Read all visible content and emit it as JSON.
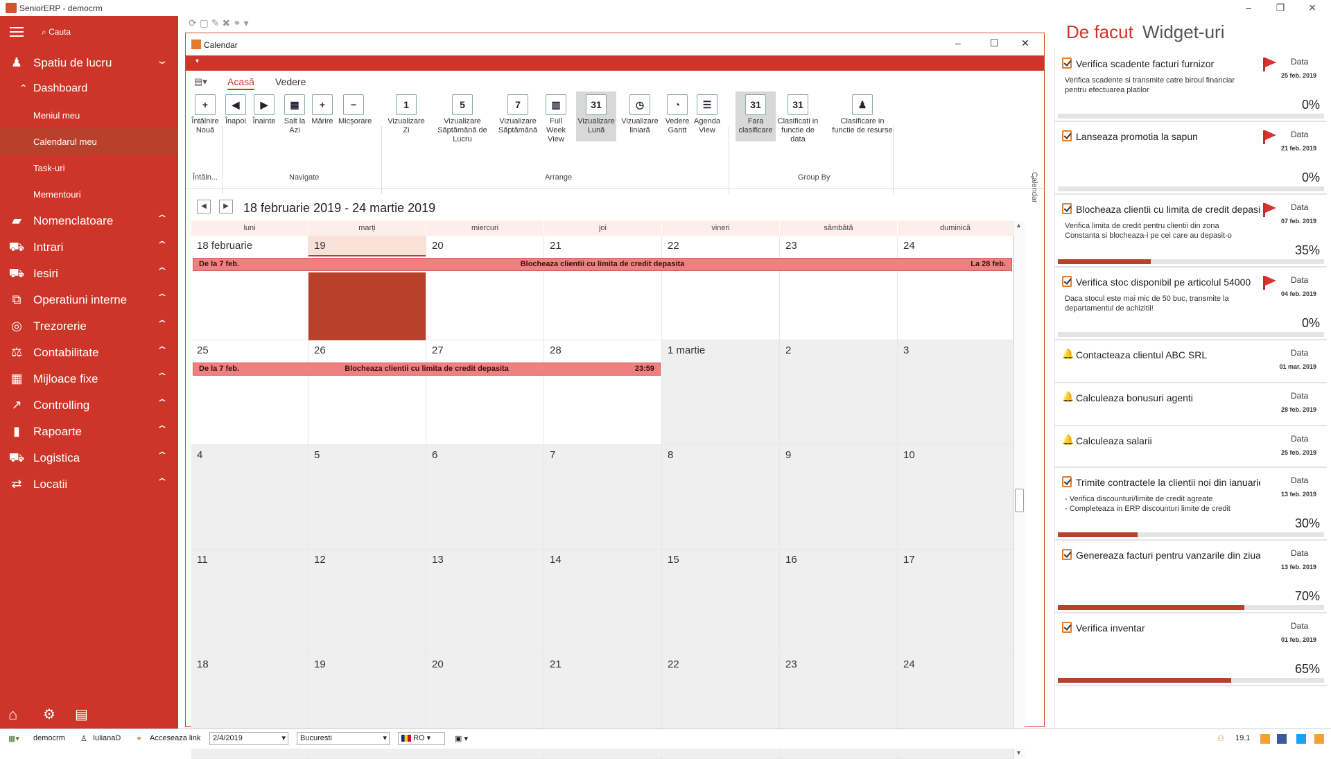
{
  "window": {
    "title": "SeniorERP - democrm"
  },
  "sidebar": {
    "search": "Cauta",
    "items": [
      {
        "label": "Spatiu de lucru",
        "icon": "person-icon",
        "chevron": "down"
      },
      {
        "label": "Nomenclatoare",
        "icon": "folder-icon",
        "chevron": "up"
      },
      {
        "label": "Intrari",
        "icon": "cart-in-icon",
        "chevron": "up"
      },
      {
        "label": "Iesiri",
        "icon": "cart-out-icon",
        "chevron": "up"
      },
      {
        "label": "Operatiuni interne",
        "icon": "internal-ops-icon",
        "chevron": "up"
      },
      {
        "label": "Trezorerie",
        "icon": "coins-icon",
        "chevron": "up"
      },
      {
        "label": "Contabilitate",
        "icon": "scale-icon",
        "chevron": "up"
      },
      {
        "label": "Mijloace fixe",
        "icon": "building-icon",
        "chevron": "up"
      },
      {
        "label": "Controlling",
        "icon": "trend-icon",
        "chevron": "up"
      },
      {
        "label": "Rapoarte",
        "icon": "bar-chart-icon",
        "chevron": "up"
      },
      {
        "label": "Logistica",
        "icon": "truck-icon",
        "chevron": "up"
      },
      {
        "label": "Locatii",
        "icon": "arrows-icon",
        "chevron": "up"
      }
    ],
    "dashboard": "Dashboard",
    "subitems": [
      "Meniul meu",
      "Calendarul meu",
      "Task-uri",
      "Mementouri"
    ]
  },
  "calendar_window": {
    "title": "Calendar",
    "tabs": [
      "Acasă",
      "Vedere"
    ],
    "buttons": [
      {
        "label": "Întâlnire Nouă",
        "glyph": "+"
      },
      {
        "label": "Înapoi",
        "glyph": "◀"
      },
      {
        "label": "Înainte",
        "glyph": "▶"
      },
      {
        "label": "Salt la Azi",
        "glyph": "▦"
      },
      {
        "label": "Mărire",
        "glyph": "+"
      },
      {
        "label": "Micșorare",
        "glyph": "−"
      },
      {
        "label": "Vizualizare Zi",
        "glyph": "1"
      },
      {
        "label": "Vizualizare Săptămână de Lucru",
        "glyph": "5"
      },
      {
        "label": "Vizualizare Săptămână",
        "glyph": "7"
      },
      {
        "label": "Full Week View",
        "glyph": "▥"
      },
      {
        "label": "Vizualizare Lună",
        "glyph": "31"
      },
      {
        "label": "Vizualizare liniară",
        "glyph": "◷"
      },
      {
        "label": "Vedere Gantt",
        "glyph": "◔"
      },
      {
        "label": "Agenda View",
        "glyph": "☰"
      },
      {
        "label": "Fara clasificare",
        "glyph": "31"
      },
      {
        "label": "Clasificati in functie de data",
        "glyph": "31"
      },
      {
        "label": "Clasificare in functie de resurse",
        "glyph": "♟"
      }
    ],
    "groups": [
      "Întâln...",
      "Navigate",
      "Arrange",
      "Group By"
    ],
    "range_title": "18 februarie 2019 - 24 martie 2019",
    "side_tab": "Calendar",
    "day_headers": [
      "luni",
      "marți",
      "miercuri",
      "joi",
      "vineri",
      "sâmbătă",
      "duminică"
    ],
    "weeks": [
      [
        "18 februarie",
        "19",
        "20",
        "21",
        "22",
        "23",
        "24"
      ],
      [
        "25",
        "26",
        "27",
        "28",
        "1 martie",
        "2",
        "3"
      ],
      [
        "4",
        "5",
        "6",
        "7",
        "8",
        "9",
        "10"
      ],
      [
        "11",
        "12",
        "13",
        "14",
        "15",
        "16",
        "17"
      ],
      [
        "18",
        "19",
        "20",
        "21",
        "22",
        "23",
        "24"
      ]
    ],
    "events": [
      {
        "from": "De la 7 feb.",
        "title": "Blocheaza clientii cu limita de credit depasita",
        "to": "La 28 feb."
      },
      {
        "from": "De la 7 feb.",
        "title": "Blocheaza clientii cu limita de credit depasita",
        "to": "23:59"
      }
    ]
  },
  "right_panel": {
    "tab1": "De facut",
    "tab2": "Widget-uri",
    "accent": "#cd3528",
    "tasks": [
      {
        "type": "check",
        "title": "Verifica scadente facturi furnizor",
        "flag": true,
        "date_label": "Data",
        "date": "25 feb. 2019",
        "desc": "Verifica scadente si transmite catre biroul financiar pentru efectuarea platilor",
        "percent": "0%",
        "progress": 0
      },
      {
        "type": "check",
        "title": "Lanseaza promotia la sapun",
        "flag": true,
        "date_label": "Data",
        "date": "21 feb. 2019",
        "desc": "",
        "percent": "0%",
        "progress": 0
      },
      {
        "type": "check",
        "title": "Blocheaza clientii cu limita de credit depasita",
        "flag": true,
        "date_label": "Data",
        "date": "07 feb. 2019",
        "desc": "Verifica limita de credit pentru clientii din zona Constanta si blocheaza-i pe cei care au depasit-o",
        "percent": "35%",
        "progress": 0.35
      },
      {
        "type": "check",
        "title": "Verifica stoc disponibil pe articolul 54000",
        "flag": true,
        "date_label": "Data",
        "date": "04 feb. 2019",
        "desc": "Daca stocul este mai mic de 50 buc, transmite la departamentul de achizitii!",
        "percent": "0%",
        "progress": 0
      },
      {
        "type": "bell",
        "title": "Contacteaza clientul ABC SRL",
        "flag": false,
        "date_label": "Data",
        "date": "01 mar. 2019",
        "desc": "",
        "percent": "",
        "progress": null
      },
      {
        "type": "bell",
        "title": "Calculeaza bonusuri agenti",
        "flag": false,
        "date_label": "Data",
        "date": "28 feb. 2019",
        "desc": "",
        "percent": "",
        "progress": null
      },
      {
        "type": "bell",
        "title": "Calculeaza salarii",
        "flag": false,
        "date_label": "Data",
        "date": "25 feb. 2019",
        "desc": "",
        "percent": "",
        "progress": null
      },
      {
        "type": "check",
        "title": "Trimite contractele la clientii noi din ianuarie",
        "flag": false,
        "date_label": "Data",
        "date": "13 feb. 2019",
        "desc": "- Verifica discounturi/limite de credit agreate\n- Completeaza in ERP discounturi  limite de credit",
        "percent": "30%",
        "progress": 0.3
      },
      {
        "type": "check",
        "title": "Genereaza facturi pentru vanzarile din ziua",
        "flag": false,
        "date_label": "Data",
        "date": "13 feb. 2019",
        "desc": "",
        "percent": "70%",
        "progress": 0.7
      },
      {
        "type": "check",
        "title": "Verifica inventar",
        "flag": false,
        "date_label": "Data",
        "date": "01 feb. 2019",
        "desc": "",
        "percent": "65%",
        "progress": 0.65
      }
    ]
  },
  "statusbar": {
    "db": "democrm",
    "user": "IulianaD",
    "link": "Acceseaza link",
    "date": "2/4/2019",
    "city": "Bucuresti",
    "lang": "RO",
    "zoom": "19.1"
  }
}
